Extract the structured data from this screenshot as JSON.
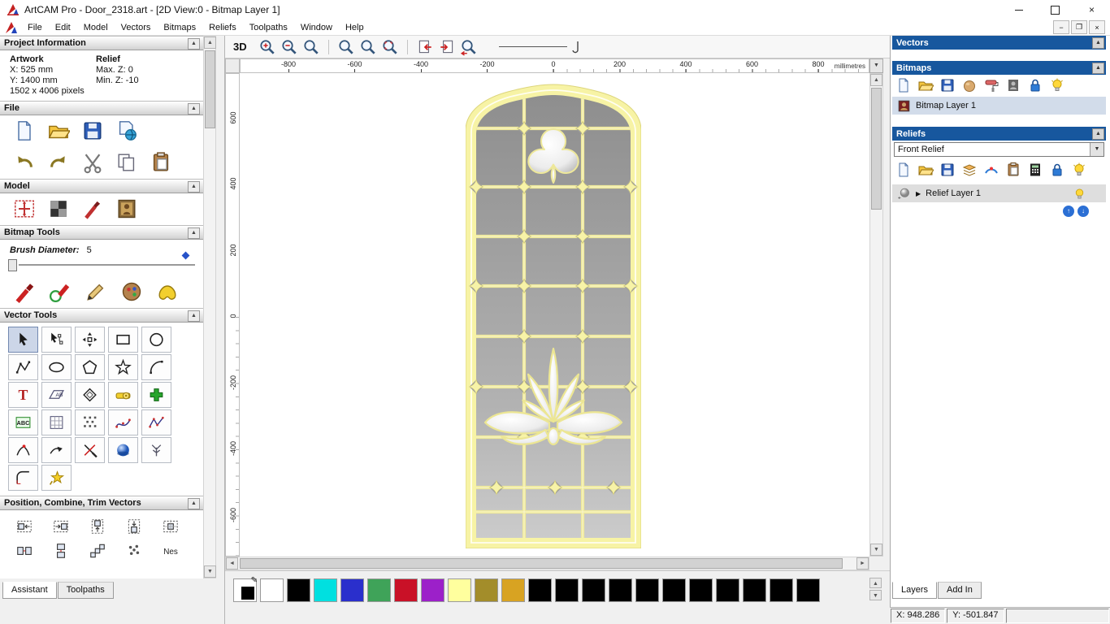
{
  "window": {
    "title": "ArtCAM Pro - Door_2318.art - [2D View:0 - Bitmap Layer 1]"
  },
  "menu": {
    "items": [
      "File",
      "Edit",
      "Model",
      "Vectors",
      "Bitmaps",
      "Reliefs",
      "Toolpaths",
      "Window",
      "Help"
    ]
  },
  "assistant": {
    "project_info": {
      "title": "Project Information",
      "artwork_header": "Artwork",
      "relief_header": "Relief",
      "artwork_x": "X: 525 mm",
      "artwork_y": "Y: 1400 mm",
      "artwork_pixels": "1502 x 4006 pixels",
      "relief_max_z": "Max. Z: 0",
      "relief_min_z": "Min. Z: -10"
    },
    "file": {
      "title": "File",
      "row1": [
        "new-model-icon",
        "open-model-icon",
        "save-model-icon",
        "export-model-icon"
      ],
      "row2": [
        "undo-icon",
        "redo-icon",
        "cut-icon",
        "copy-icon",
        "paste-icon"
      ]
    },
    "model": {
      "title": "Model",
      "row1": [
        "set-model-size-icon",
        "adjust-model-icon",
        "edit-model-icon",
        "load-image-icon"
      ]
    },
    "bitmap_tools": {
      "title": "Bitmap Tools",
      "brush_label": "Brush Diameter:",
      "brush_value": "5",
      "row1": [
        "paint-icon",
        "paint-selective-icon",
        "draw-icon",
        "colour-reduce-icon",
        "flood-fill-icon"
      ]
    },
    "vector_tools": {
      "title": "Vector Tools",
      "selected": "select-vectors-icon",
      "tools": [
        "select-vectors-icon",
        "node-editing-icon",
        "transform-vectors-icon",
        "create-rectangle-icon",
        "create-circle-icon",
        "create-polyline-icon",
        "create-ellipse-icon",
        "create-polygon-icon",
        "create-star-icon",
        "create-arc-icon",
        "create-text-icon",
        "wrap-text-icon",
        "offset-vector-icon",
        "measure-icon",
        "paste-vector-icon",
        "text-block-icon",
        "bitmap-to-vector-icon",
        "nesting-dots-icon",
        "fit-curve-icon",
        "fit-polyline-icon",
        "join-vectors-icon",
        "direction-icon",
        "trim-vectors-icon",
        "interpolate-icon",
        "spline-icon",
        "fillet-icon",
        "vector-doctor-icon"
      ]
    },
    "position": {
      "title": "Position, Combine, Trim Vectors",
      "tools": [
        "align-left-icon",
        "align-right-icon",
        "align-top-icon",
        "align-bottom-icon",
        "align-centre-icon",
        "align-horizontal-icon",
        "align-vertical-icon",
        "spread-icon",
        "cluster-icon",
        "nesting-icon"
      ]
    },
    "tabs": [
      {
        "label": "Assistant",
        "active": true
      },
      {
        "label": "Toolpaths",
        "active": false
      }
    ]
  },
  "view": {
    "toolbar": {
      "label_3d": "3D",
      "group1": [
        "zoom-in-icon",
        "zoom-out-icon",
        "zoom-last-icon"
      ],
      "group2": [
        "zoom-objects-icon",
        "zoom-page-icon",
        "zoom-limits-icon"
      ],
      "group3": [
        "previous-view-icon",
        "next-view-icon"
      ],
      "group4": [
        "zoom-back-icon"
      ]
    },
    "ruler": {
      "h_values": [
        -800,
        -600,
        -400,
        -200,
        0,
        200,
        400,
        600,
        800
      ],
      "unit": "millimetres",
      "v_values": [
        600,
        400,
        200,
        0,
        -200,
        -400,
        -600
      ]
    },
    "palette": {
      "colors": [
        "#ffffff",
        "#000000",
        "#00e0e0",
        "#2a2fcc",
        "#3fa359",
        "#c91127",
        "#9c20c9",
        "#ffff9e",
        "#a38d2a",
        "#d8a322",
        "#000000",
        "#000000",
        "#000000",
        "#000000",
        "#000000",
        "#000000",
        "#000000",
        "#000000",
        "#000000",
        "#000000",
        "#000000"
      ]
    }
  },
  "layers_panel": {
    "vectors": {
      "title": "Vectors"
    },
    "bitmaps": {
      "title": "Bitmaps",
      "toolbar": [
        "new-bitmap-icon",
        "open-bitmap-icon",
        "save-bitmap-icon",
        "clay-icon",
        "roller-icon",
        "greyscale-icon",
        "lock-icon",
        "light-icon"
      ],
      "layer_name": "Bitmap Layer 1"
    },
    "reliefs": {
      "title": "Reliefs",
      "combo_value": "Front Relief",
      "toolbar": [
        "new-relief-icon",
        "open-relief-icon",
        "save-relief-icon",
        "layer-stack-icon",
        "smooth-icon",
        "clipboard-icon",
        "calculator-icon",
        "lock-icon",
        "light-icon"
      ],
      "layer_name": "Relief Layer 1"
    },
    "tabs": [
      {
        "label": "Layers",
        "active": true
      },
      {
        "label": "Add In",
        "active": false
      }
    ]
  },
  "status": {
    "x": "X: 948.286",
    "y": "Y: -501.847"
  }
}
